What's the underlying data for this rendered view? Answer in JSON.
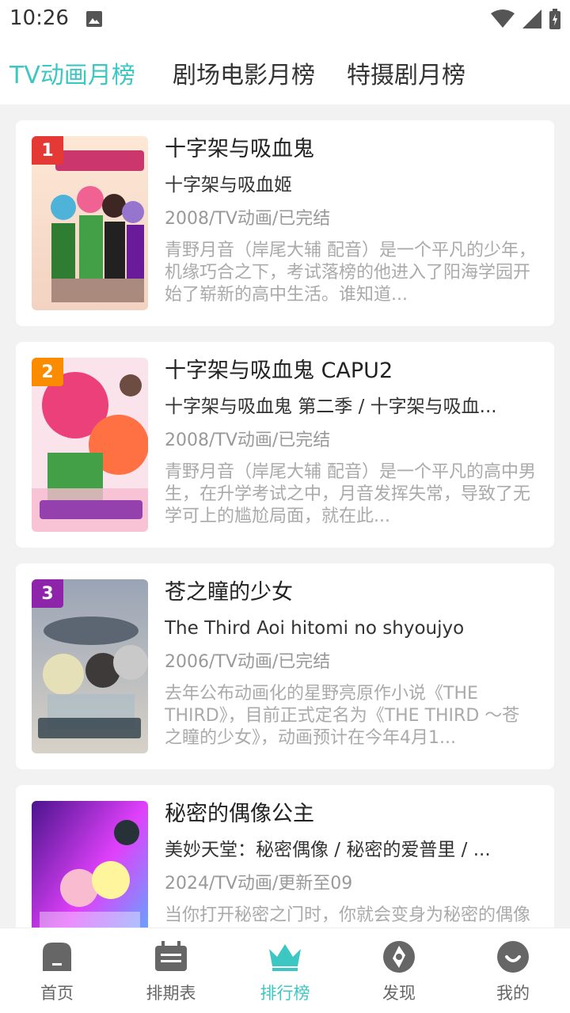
{
  "status_bar": {
    "time": "10:26"
  },
  "top_tabs": [
    {
      "label": "TV动画月榜",
      "active": true
    },
    {
      "label": "剧场电影月榜",
      "active": false
    },
    {
      "label": "特摄剧月榜",
      "active": false
    }
  ],
  "items": [
    {
      "rank": "1",
      "rank_color": "#e53935",
      "title": "十字架与吸血鬼",
      "alias": "十字架与吸血姬",
      "meta": "2008/TV动画/已完结",
      "desc": "青野月音（岸尾大辅 配音）是一个平凡的少年，机缘巧合之下，考试落榜的他进入了阳海学园开始了崭新的高中生活。谁知道..."
    },
    {
      "rank": "2",
      "rank_color": "#fb8c00",
      "title": "十字架与吸血鬼 CAPU2",
      "alias": "十字架与吸血鬼 第二季 / 十字架与吸血...",
      "meta": "2008/TV动画/已完结",
      "desc": "青野月音（岸尾大辅 配音）是一个平凡的高中男生，在升学考试之中，月音发挥失常，导致了无学可上的尴尬局面，就在此..."
    },
    {
      "rank": "3",
      "rank_color": "#8e24aa",
      "title": "苍之瞳的少女",
      "alias": "The Third Aoi hitomi no shyoujyo",
      "meta": "2006/TV动画/已完结",
      "desc": "去年公布动画化的星野亮原作小说《THE THIRD》，目前正式定名为《THE THIRD ～苍之瞳的少女》，动画预计在今年4月1..."
    },
    {
      "rank": "",
      "rank_color": "",
      "title": "秘密的偶像公主",
      "alias": "美妙天堂：秘密偶像 / 秘密的爱普里 / ...",
      "meta": "2024/TV动画/更新至09",
      "desc": "当你打开秘密之门时，你就会变身为秘密的偶像公主……"
    }
  ],
  "bottom_nav": [
    {
      "label": "首页",
      "icon": "home-icon",
      "active": false
    },
    {
      "label": "排期表",
      "icon": "schedule-icon",
      "active": false
    },
    {
      "label": "排行榜",
      "icon": "crown-icon",
      "active": true
    },
    {
      "label": "发现",
      "icon": "discover-icon",
      "active": false
    },
    {
      "label": "我的",
      "icon": "profile-icon",
      "active": false
    }
  ],
  "colors": {
    "accent": "#3cc7c2",
    "background": "#f2f2f2"
  }
}
